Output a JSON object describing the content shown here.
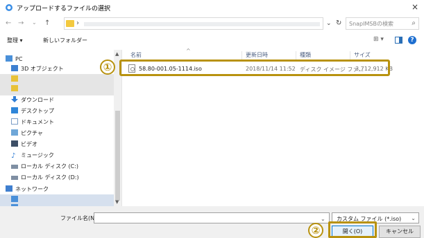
{
  "window": {
    "title": "アップロードするファイルの選択",
    "close_icon": "×"
  },
  "addressbar": {
    "back_icon": "←",
    "forward_icon": "→",
    "recent_icon": "⌄",
    "up_icon": "↑",
    "path_sep": "›",
    "dropdown_icon": "⌄",
    "refresh_icon": "↻",
    "search_placeholder": "SnapIMSBの検索",
    "search_icon": "⌕"
  },
  "toolbar": {
    "organize": "整理 ▾",
    "new_folder": "新しいフォルダー",
    "view_icon": "⊞ ▾",
    "help": "?"
  },
  "nav": {
    "items": [
      {
        "label": "PC",
        "icon": "pc-icon"
      },
      {
        "label": "3D オブジェクト",
        "icon": "3d-objects-icon"
      },
      {
        "label": "",
        "icon": "folder-icon"
      },
      {
        "label": "",
        "icon": "folder-icon"
      },
      {
        "label": "ダウンロード",
        "icon": "download-icon"
      },
      {
        "label": "デスクトップ",
        "icon": "desktop-icon"
      },
      {
        "label": "ドキュメント",
        "icon": "document-icon"
      },
      {
        "label": "ピクチャ",
        "icon": "picture-icon"
      },
      {
        "label": "ビデオ",
        "icon": "video-icon"
      },
      {
        "label": "ミュージック",
        "icon": "music-icon"
      },
      {
        "label": "ローカル ディスク (C:)",
        "icon": "drive-icon"
      },
      {
        "label": "ローカル ディスク (D:)",
        "icon": "drive-icon"
      },
      {
        "label": "ネットワーク",
        "icon": "network-icon"
      },
      {
        "label": "",
        "icon": "network-computer-icon"
      },
      {
        "label": "",
        "icon": "network-computer-icon"
      }
    ]
  },
  "filelist": {
    "columns": [
      "名前",
      "更新日時",
      "種類",
      "サイズ"
    ],
    "sort_indicator": "^",
    "files": [
      {
        "name": "58.80-001.05-1114.iso",
        "modified": "2018/11/14 11:52",
        "type": "ディスク イメージ ファ...",
        "size": "3,712,912 KB"
      }
    ]
  },
  "bottom": {
    "filename_label": "ファイル名(N):",
    "filename_value": "",
    "filter_value": "カスタム ファイル (*.iso)",
    "open_button": "開く(O)",
    "cancel_button": "キャンセル"
  },
  "annotations": {
    "step1": "①",
    "step2": "②",
    "color": "#b8920f"
  }
}
